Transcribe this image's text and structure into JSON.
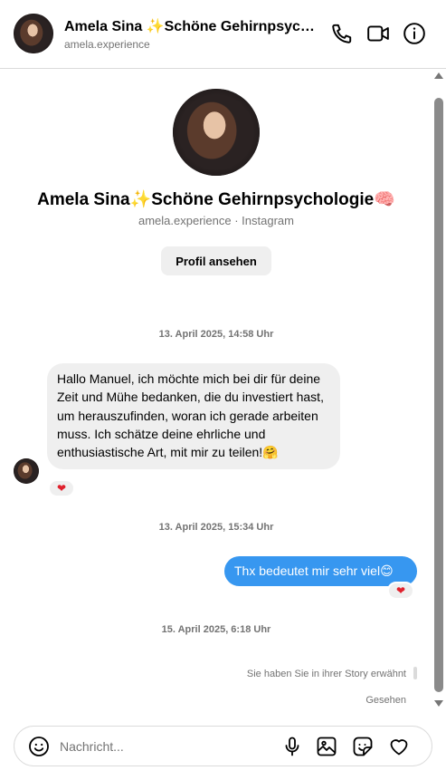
{
  "header": {
    "name": "Amela Sina ✨Schöne Gehirnpsycho...",
    "username": "amela.experience",
    "icons": [
      "phone-icon",
      "video-icon",
      "info-icon"
    ]
  },
  "profile": {
    "name": "Amela Sina✨Schöne Gehirnpsychologie🧠",
    "subtitle": "amela.experience · Instagram",
    "view_profile_label": "Profil ansehen"
  },
  "messages": [
    {
      "timestamp": "13. April 2025, 14:58 Uhr"
    },
    {
      "text": "Hallo Manuel, ich möchte mich bei dir für deine Zeit und Mühe bedanken, die du investiert hast, um herauszufinden, woran ich gerade arbeiten muss. Ich schätze deine ehrliche und enthusiastische Art, mit mir zu teilen!🤗",
      "reaction": "❤"
    },
    {
      "timestamp": "13. April 2025, 15:34 Uhr"
    },
    {
      "text": "Thx bedeutet mir sehr viel😊",
      "reaction": "❤"
    },
    {
      "timestamp": "15. April 2025, 6:18 Uhr"
    }
  ],
  "story_mention": "Sie haben Sie in ihrer Story erwähnt",
  "seen_label": "Gesehen",
  "composer": {
    "placeholder": "Nachricht...",
    "icons": [
      "emoji-icon",
      "microphone-icon",
      "image-icon",
      "sticker-icon",
      "heart-icon"
    ]
  },
  "colors": {
    "accent_blue": "#3797f0",
    "reaction_red": "#e0202c",
    "bubble_gray": "#efefef"
  }
}
